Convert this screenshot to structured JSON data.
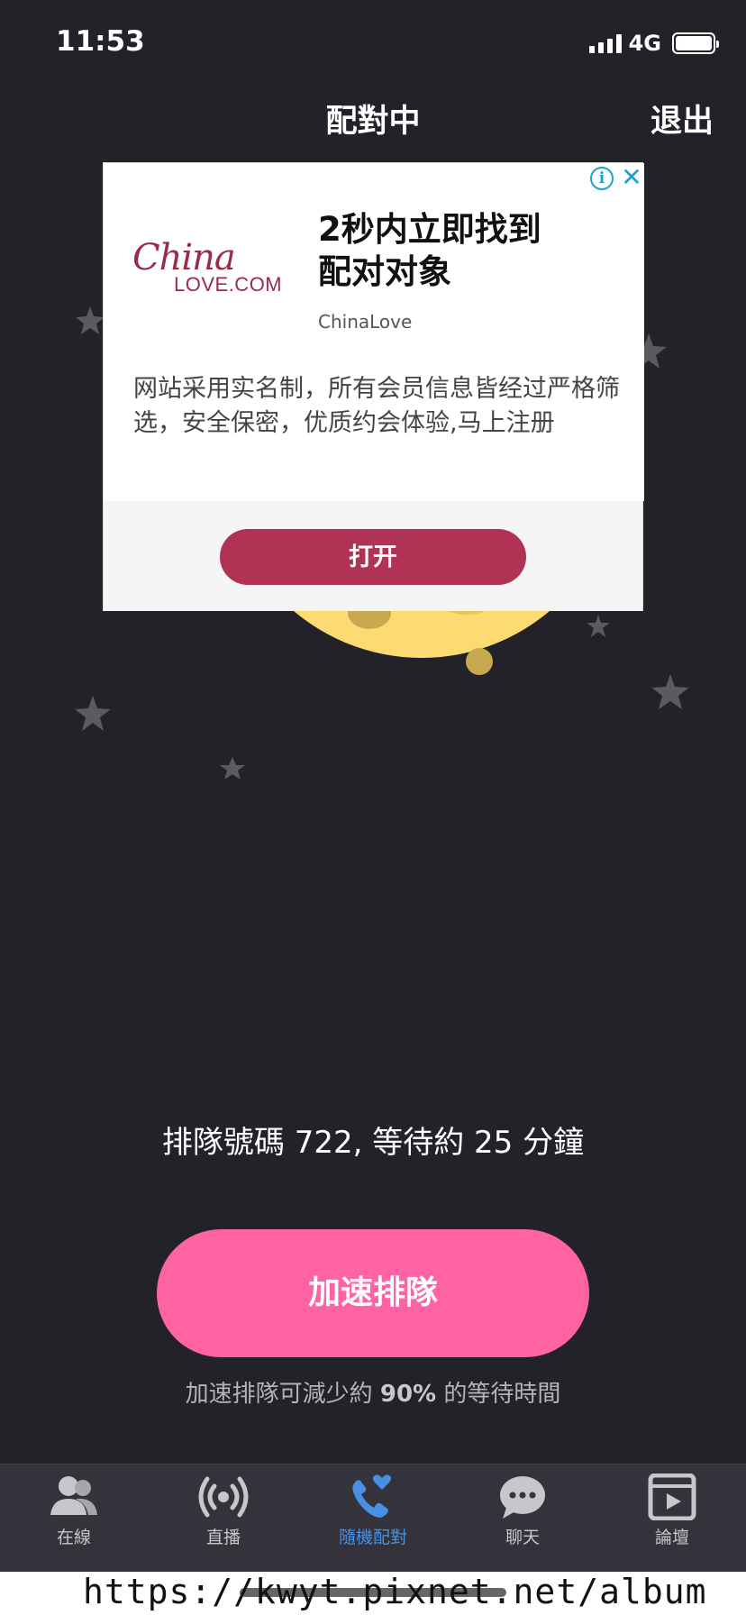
{
  "status": {
    "time": "11:53",
    "network": "4G"
  },
  "nav": {
    "title": "配對中",
    "exit": "退出"
  },
  "ad": {
    "logo_script": "China",
    "logo_sub": "LOVE.COM",
    "headline_line1": "2秒内立即找到",
    "headline_line2": "配对对象",
    "brand": "ChinaLove",
    "body": "网站采用实名制，所有会员信息皆经过严格筛选，安全保密，优质约会体验,马上注册",
    "cta": "打开",
    "info_glyph": "i",
    "close_glyph": "✕"
  },
  "queue": {
    "text": "排隊號碼 722, 等待約 25 分鐘"
  },
  "speed_button": {
    "label": "加速排隊"
  },
  "speed_hint": {
    "before": "加速排隊可減少約",
    "percent": "90%",
    "after": "的等待時間"
  },
  "tabs": [
    {
      "label": "在線",
      "icon": "users-icon",
      "active": false
    },
    {
      "label": "直播",
      "icon": "broadcast-icon",
      "active": false
    },
    {
      "label": "隨機配對",
      "icon": "phone-heart-icon",
      "active": true
    },
    {
      "label": "聊天",
      "icon": "chat-bubble-icon",
      "active": false
    },
    {
      "label": "論壇",
      "icon": "forum-icon",
      "active": false
    }
  ],
  "watermark": "https://kwyt.pixnet.net/album",
  "colors": {
    "background": "#242229",
    "accent_pink": "#ff63a3",
    "ad_cta": "#b03356",
    "active_tab": "#4a90e2",
    "moon": "#fcdc72"
  }
}
